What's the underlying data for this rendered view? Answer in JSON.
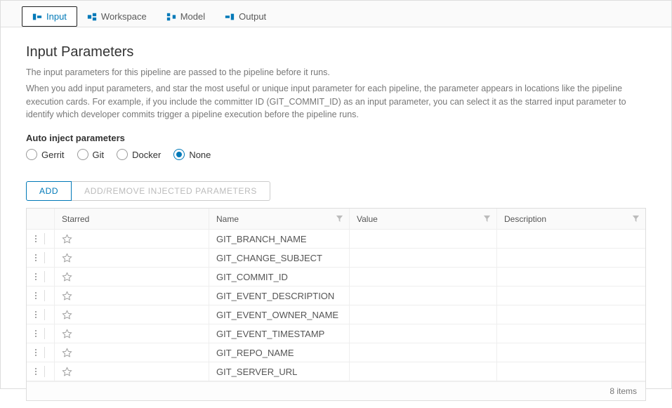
{
  "tabs": [
    {
      "label": "Input",
      "active": true
    },
    {
      "label": "Workspace",
      "active": false
    },
    {
      "label": "Model",
      "active": false
    },
    {
      "label": "Output",
      "active": false
    }
  ],
  "page_title": "Input Parameters",
  "desc1": "The input parameters for this pipeline are passed to the pipeline before it runs.",
  "desc2": "When you add input parameters, and star the most useful or unique input parameter for each pipeline, the parameter appears in locations like the pipeline execution cards. For example, if you include the committer ID (GIT_COMMIT_ID) as an input parameter, you can select it as the starred input parameter to identify which developer commits trigger a pipeline execution before the pipeline runs.",
  "auto_inject": {
    "label": "Auto inject parameters",
    "options": [
      {
        "label": "Gerrit",
        "selected": false
      },
      {
        "label": "Git",
        "selected": false
      },
      {
        "label": "Docker",
        "selected": false
      },
      {
        "label": "None",
        "selected": true
      }
    ]
  },
  "buttons": {
    "add": "ADD",
    "injected": "ADD/REMOVE INJECTED PARAMETERS"
  },
  "columns": {
    "starred": "Starred",
    "name": "Name",
    "value": "Value",
    "description": "Description"
  },
  "rows": [
    {
      "name": "GIT_BRANCH_NAME",
      "value": "",
      "description": ""
    },
    {
      "name": "GIT_CHANGE_SUBJECT",
      "value": "",
      "description": ""
    },
    {
      "name": "GIT_COMMIT_ID",
      "value": "",
      "description": ""
    },
    {
      "name": "GIT_EVENT_DESCRIPTION",
      "value": "",
      "description": ""
    },
    {
      "name": "GIT_EVENT_OWNER_NAME",
      "value": "",
      "description": ""
    },
    {
      "name": "GIT_EVENT_TIMESTAMP",
      "value": "",
      "description": ""
    },
    {
      "name": "GIT_REPO_NAME",
      "value": "",
      "description": ""
    },
    {
      "name": "GIT_SERVER_URL",
      "value": "",
      "description": ""
    }
  ],
  "footer_count": "8 items"
}
